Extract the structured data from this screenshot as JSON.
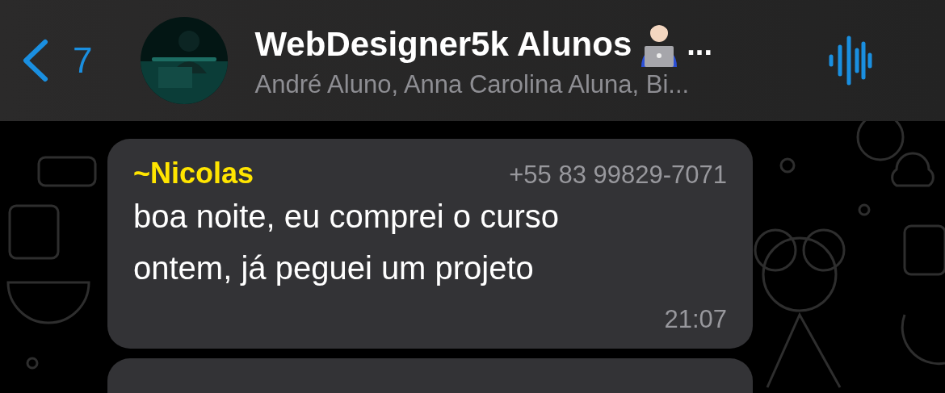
{
  "header": {
    "back_count": "7",
    "title": "WebDesigner5k Alunos",
    "title_more": "...",
    "subtitle": "André Aluno, Anna Carolina Aluna, Bi..."
  },
  "messages": [
    {
      "sender": "~Nicolas",
      "color": "#ffe500",
      "phone": "+55 83 99829-7071",
      "lines": [
        "boa noite, eu comprei o curso",
        "ontem, já peguei um projeto"
      ],
      "time": "21:07"
    },
    {
      "kind": "partial"
    }
  ]
}
